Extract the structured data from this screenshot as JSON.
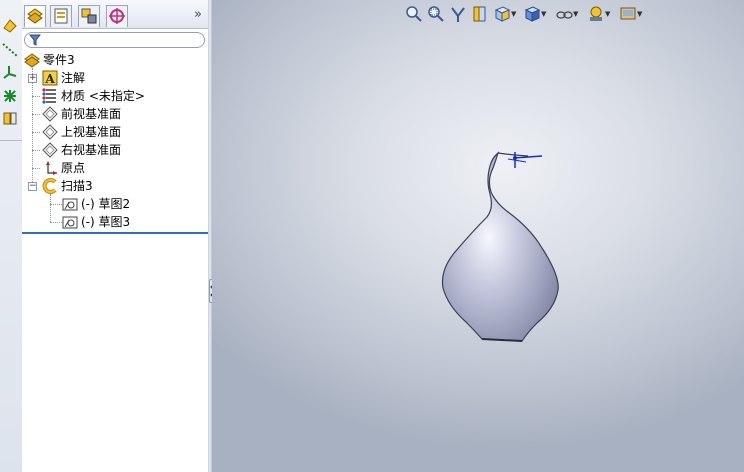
{
  "feature_manager": {
    "tabs": [
      "feature-manager-tab",
      "property-manager-tab",
      "configuration-manager-tab",
      "dimxpert-tab"
    ],
    "expand_glyph": "»",
    "filter_placeholder": "",
    "tree": [
      {
        "label": "零件3",
        "icon": "part-icon"
      },
      {
        "label": "注解",
        "icon": "annotations-icon",
        "expander": "+"
      },
      {
        "label": "材质 <未指定>",
        "icon": "material-icon"
      },
      {
        "label": "前视基准面",
        "icon": "plane-icon"
      },
      {
        "label": "上视基准面",
        "icon": "plane-icon"
      },
      {
        "label": "右视基准面",
        "icon": "plane-icon"
      },
      {
        "label": "原点",
        "icon": "origin-icon"
      },
      {
        "label": "扫描3",
        "icon": "sweep-icon",
        "expander": "−"
      },
      {
        "label": "(-) 草图2",
        "icon": "sketch-icon"
      },
      {
        "label": "(-) 草图3",
        "icon": "sketch-icon"
      }
    ]
  },
  "left_toolbar": [
    "dimension-tool-icon",
    "line-tool-icon",
    "axis-tool-icon",
    "point-tool-icon",
    "component-tool-icon"
  ],
  "view_toolbar": [
    "zoom-to-fit-icon",
    "zoom-to-area-icon",
    "previous-view-icon",
    "section-view-icon",
    "view-orientation-icon",
    "display-style-icon",
    "hide-show-items-icon",
    "edit-appearance-icon",
    "apply-scene-icon"
  ],
  "colors": {
    "accent": "#2e6fb7",
    "model": "#b9bdd6"
  }
}
